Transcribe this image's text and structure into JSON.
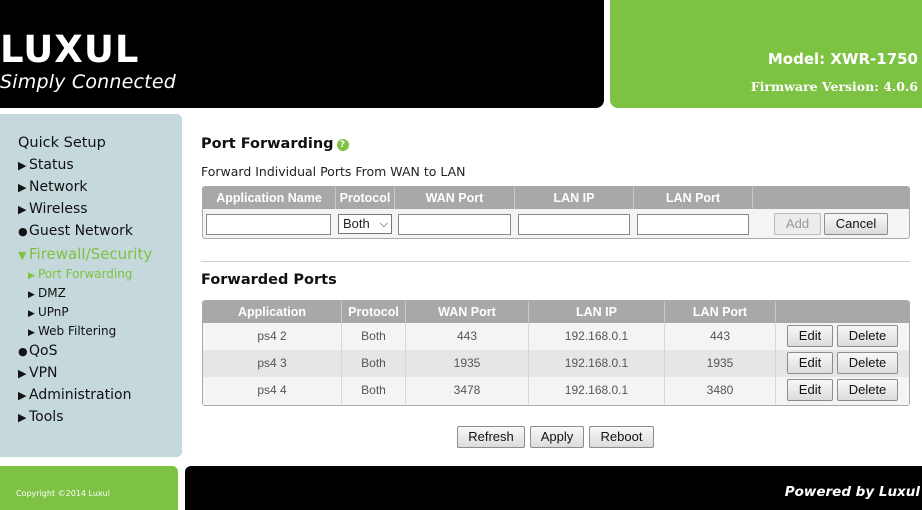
{
  "header": {
    "brand": "LUXUL",
    "tagline": "Simply Connected",
    "model": "Model: XWR-1750",
    "firmware": "Firmware Version: 4.0.6"
  },
  "sidebar": {
    "top": "Quick Setup",
    "items": [
      {
        "label": "Status",
        "marker": "▶"
      },
      {
        "label": "Network",
        "marker": "▶"
      },
      {
        "label": "Wireless",
        "marker": "▶"
      },
      {
        "label": "Guest Network",
        "marker": "●"
      },
      {
        "label": "Firewall/Security",
        "marker": "▼"
      },
      {
        "label": "QoS",
        "marker": "●"
      },
      {
        "label": "VPN",
        "marker": "▶"
      },
      {
        "label": "Administration",
        "marker": "▶"
      },
      {
        "label": "Tools",
        "marker": "▶"
      }
    ],
    "subitems": [
      {
        "label": "Port Forwarding",
        "marker": "▶"
      },
      {
        "label": "DMZ",
        "marker": "▶"
      },
      {
        "label": "UPnP",
        "marker": "▶"
      },
      {
        "label": "Web Filtering",
        "marker": "▶"
      }
    ]
  },
  "page": {
    "title": "Port Forwarding",
    "help_icon": "?",
    "description": "Forward Individual Ports From WAN to LAN"
  },
  "add_form": {
    "headers": [
      "Application Name",
      "Protocol",
      "WAN Port",
      "LAN IP",
      "LAN Port",
      ""
    ],
    "application_name": "",
    "protocol_selected": "Both",
    "wan_port": "",
    "lan_ip": "",
    "lan_port": "",
    "add_label": "Add",
    "cancel_label": "Cancel"
  },
  "forwarded": {
    "title": "Forwarded Ports",
    "headers": [
      "Application",
      "Protocol",
      "WAN Port",
      "LAN IP",
      "LAN Port",
      ""
    ],
    "rows": [
      {
        "application": "ps4 2",
        "protocol": "Both",
        "wan_port": "443",
        "lan_ip": "192.168.0.1",
        "lan_port": "443"
      },
      {
        "application": "ps4 3",
        "protocol": "Both",
        "wan_port": "1935",
        "lan_ip": "192.168.0.1",
        "lan_port": "1935"
      },
      {
        "application": "ps4 4",
        "protocol": "Both",
        "wan_port": "3478",
        "lan_ip": "192.168.0.1",
        "lan_port": "3480"
      }
    ],
    "edit_label": "Edit",
    "delete_label": "Delete"
  },
  "actions": {
    "refresh": "Refresh",
    "apply": "Apply",
    "reboot": "Reboot"
  },
  "footer": {
    "copyright": "Copyright ©2014 Luxul",
    "powered": "Powered by Luxul"
  },
  "colors": {
    "accent": "#7dc242",
    "header_bg": "#000000",
    "sidebar_bg": "#c5d8db",
    "table_header": "#a8a8a8"
  }
}
